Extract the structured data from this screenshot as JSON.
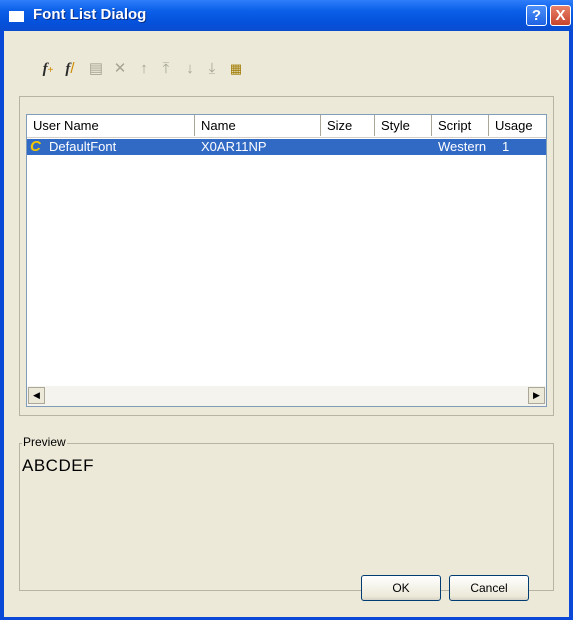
{
  "window": {
    "title": "Font List Dialog"
  },
  "caption_buttons": {
    "help": "?",
    "close": "X"
  },
  "toolbar": {
    "icons": [
      "add-font-icon",
      "edit-font-icon",
      "properties-icon",
      "delete-icon",
      "move-up-icon",
      "move-top-icon",
      "move-down-icon",
      "move-bottom-icon",
      "table-icon"
    ]
  },
  "font_list": {
    "columns": [
      "User Name",
      "Name",
      "Size",
      "Style",
      "Script",
      "Usage"
    ],
    "rows": [
      {
        "user_name": "DefaultFont",
        "name": "X0AR11NP",
        "size": "",
        "style": "",
        "script": "Western",
        "usage": "1"
      }
    ],
    "selected_row_color": "#316ac5"
  },
  "preview": {
    "label": "Preview",
    "text": "ABCDEF"
  },
  "buttons": {
    "ok": "OK",
    "cancel": "Cancel"
  }
}
